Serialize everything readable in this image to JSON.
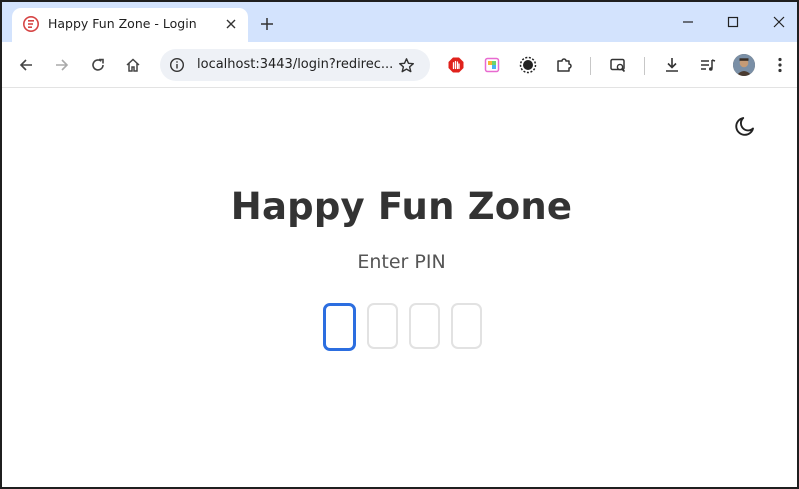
{
  "browser": {
    "tab": {
      "title": "Happy Fun Zone - Login",
      "favicon": "app-favicon"
    },
    "address_bar": {
      "url": "localhost:3443/login?redirec..."
    },
    "window_controls": [
      "minimize",
      "maximize",
      "close"
    ],
    "toolbar_icons": [
      "back-icon",
      "forward-icon",
      "reload-icon",
      "home-icon",
      "site-info-icon",
      "bookmark-star-icon",
      "extension-stop-icon",
      "extension-color-icon",
      "extension-sun-icon",
      "extensions-puzzle-icon",
      "tab-search-icon",
      "downloads-icon",
      "media-queue-icon",
      "profile-avatar",
      "more-menu-icon"
    ]
  },
  "page": {
    "title": "Happy Fun Zone",
    "pin_prompt": "Enter PIN",
    "pin": {
      "length": 4,
      "digits": [
        "",
        "",
        "",
        ""
      ],
      "active_index": 0
    },
    "theme_toggle": "moon-icon"
  },
  "colors": {
    "tab_strip": "#d3e3fd",
    "pin_active_border": "#2c6ee0",
    "pin_border": "#e2e2e2",
    "title_text": "#333333",
    "prompt_text": "#555555"
  }
}
